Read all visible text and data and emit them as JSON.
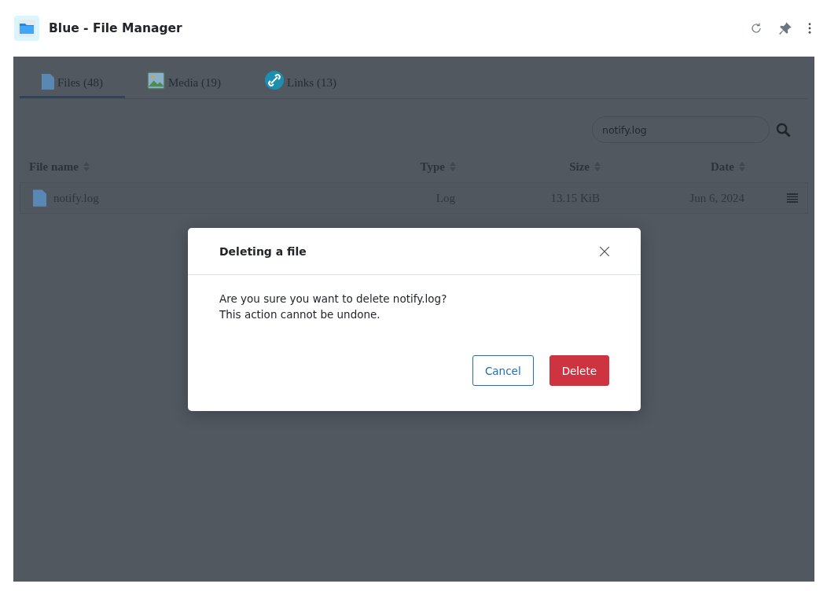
{
  "window": {
    "title": "Blue - File Manager"
  },
  "tabs": [
    {
      "label": "Files (48)",
      "kind": "file",
      "selected": true
    },
    {
      "label": "Media (19)",
      "kind": "media",
      "selected": false
    },
    {
      "label": "Links (13)",
      "kind": "link",
      "selected": false
    }
  ],
  "search": {
    "value": "notify.log"
  },
  "table": {
    "columns": [
      {
        "label": "File name"
      },
      {
        "label": "Type"
      },
      {
        "label": "Size"
      },
      {
        "label": "Date"
      }
    ],
    "rows": [
      {
        "name": "notify.log",
        "type": "Log",
        "size": "13.15 KiB",
        "date": "Jun 6, 2024"
      }
    ]
  },
  "dialog": {
    "title": "Deleting a file",
    "message_lines": [
      "Are you sure you want to delete notify.log?",
      "This action cannot be undone."
    ],
    "buttons": [
      {
        "label": "Cancel",
        "kind": "secondary"
      },
      {
        "label": "Delete",
        "kind": "danger"
      }
    ]
  }
}
